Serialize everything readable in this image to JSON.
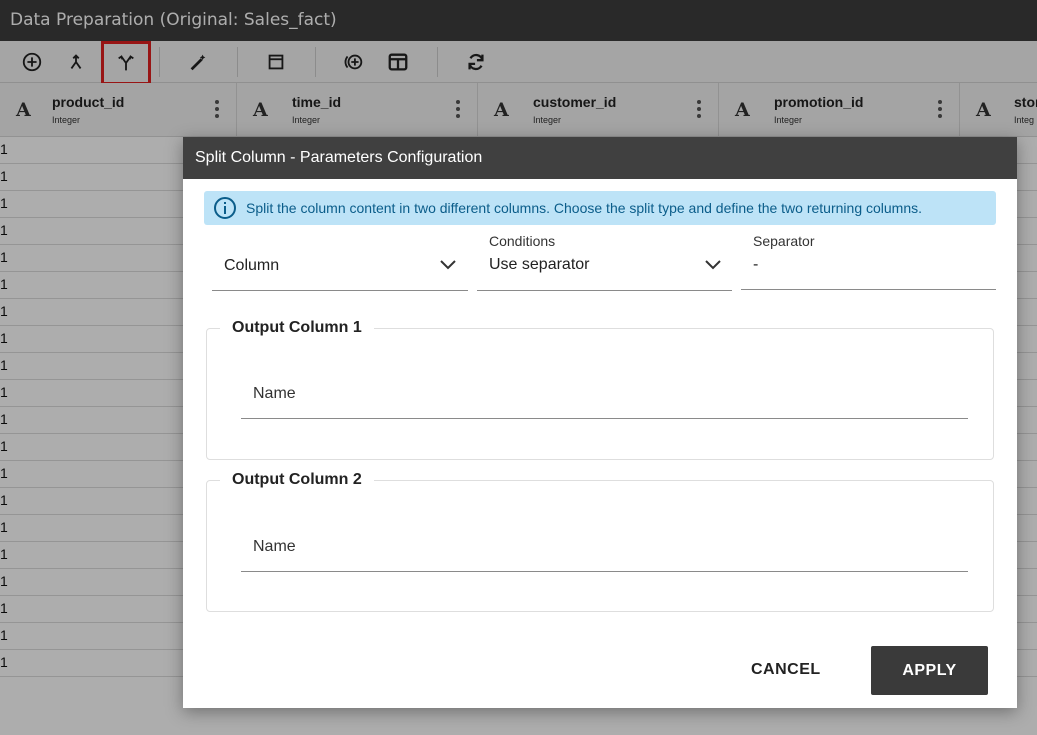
{
  "window": {
    "title": "Data Preparation (Original: Sales_fact)"
  },
  "toolbar": {
    "icons": [
      "add-circle-icon",
      "merge-icon",
      "split-icon",
      "magic-wand-icon",
      "window-icon",
      "add-column-icon",
      "columns-icon",
      "refresh-icon"
    ],
    "highlight_color": "#e02020"
  },
  "columns": [
    {
      "name": "product_id",
      "type": "Integer",
      "type_icon": "A"
    },
    {
      "name": "time_id",
      "type": "Integer",
      "type_icon": "A"
    },
    {
      "name": "customer_id",
      "type": "Integer",
      "type_icon": "A"
    },
    {
      "name": "promotion_id",
      "type": "Integer",
      "type_icon": "A"
    },
    {
      "name": "stor",
      "type": "Integ",
      "type_icon": "A"
    }
  ],
  "grid": {
    "rows": [
      "1",
      "1",
      "1",
      "1",
      "1",
      "1",
      "1",
      "1",
      "1",
      "1",
      "1",
      "1",
      "1",
      "1",
      "1",
      "1",
      "1",
      "1",
      "1",
      "1"
    ]
  },
  "dialog": {
    "title": "Split Column - Parameters Configuration",
    "info": "Split the column content in two different columns. Choose the split type and define the two returning columns.",
    "column_field": {
      "value": "Column"
    },
    "conditions_field": {
      "label": "Conditions",
      "value": "Use separator"
    },
    "separator_field": {
      "label": "Separator",
      "value": "-"
    },
    "output1": {
      "legend": "Output Column 1",
      "name_placeholder": "Name"
    },
    "output2": {
      "legend": "Output Column 2",
      "name_placeholder": "Name"
    },
    "cancel_label": "CANCEL",
    "apply_label": "APPLY"
  }
}
